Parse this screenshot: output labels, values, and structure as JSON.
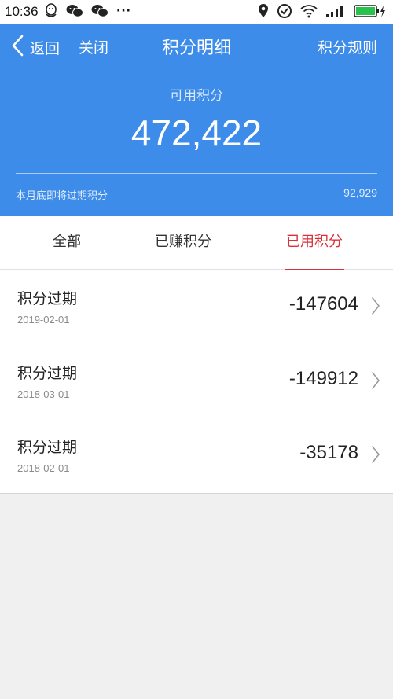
{
  "status_bar": {
    "time": "10:36",
    "left_icons": [
      "qq-icon",
      "wechat-icon",
      "wechat-icon"
    ],
    "more": "···",
    "right_icons": [
      "location-icon",
      "sync-icon",
      "wifi-icon",
      "signal-icon",
      "battery-icon"
    ]
  },
  "header": {
    "back_label": "返回",
    "close_label": "关闭",
    "title": "积分明细",
    "rules_label": "积分规则",
    "available_label": "可用积分",
    "available_points": "472,422",
    "expiring_label": "本月底即将过期积分",
    "expiring_points": "92,929"
  },
  "tabs": [
    {
      "label": "全部",
      "active": false
    },
    {
      "label": "已赚积分",
      "active": false
    },
    {
      "label": "已用积分",
      "active": true
    }
  ],
  "records": [
    {
      "title": "积分过期",
      "date": "2019-02-01",
      "amount": "-147604"
    },
    {
      "title": "积分过期",
      "date": "2018-03-01",
      "amount": "-149912"
    },
    {
      "title": "积分过期",
      "date": "2018-02-01",
      "amount": "-35178"
    }
  ],
  "colors": {
    "header_blue": "#3d8ce9",
    "accent_red": "#d8313a",
    "background": "#f0f0f0"
  }
}
